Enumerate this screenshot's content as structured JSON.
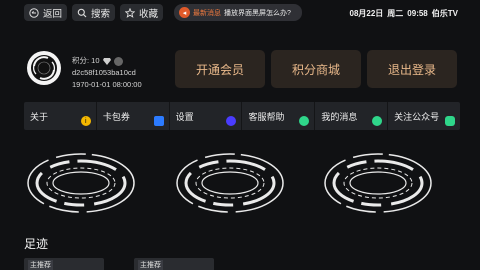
{
  "topbar": {
    "back_label": "返回",
    "search_label": "搜索",
    "favorite_label": "收藏",
    "notice_tag": "最新消息",
    "notice_text": "播放界面黑屏怎么办?",
    "date": "08月22日",
    "weekday": "周二",
    "time": "09:58",
    "brand": "伯乐TV"
  },
  "profile": {
    "points": "积分: 10",
    "user_id": "d2c58f1053ba10cd",
    "expiry": "1970-01-01 08:00:00"
  },
  "actions": {
    "vip": "开通会员",
    "points_mall": "积分商城",
    "logout": "退出登录"
  },
  "menu": [
    {
      "label": "关于",
      "icon": "info-icon",
      "color": "#f5b800"
    },
    {
      "label": "卡包券",
      "icon": "coupon-icon",
      "color": "#2c7bff"
    },
    {
      "label": "设置",
      "icon": "settings-icon",
      "color": "#4a3cff"
    },
    {
      "label": "客服帮助",
      "icon": "support-icon",
      "color": "#2fd68a"
    },
    {
      "label": "我的消息",
      "icon": "message-icon",
      "color": "#2fd68a"
    },
    {
      "label": "关注公众号",
      "icon": "wechat-icon",
      "color": "#2fd68a"
    }
  ],
  "history": {
    "title": "足迹",
    "cards": [
      {
        "tag": "主推荐"
      },
      {
        "tag": "主推荐"
      }
    ]
  },
  "colors": {
    "background": "#101113",
    "accent_text": "#e8b88a",
    "notice_accent": "#f07a3f"
  }
}
